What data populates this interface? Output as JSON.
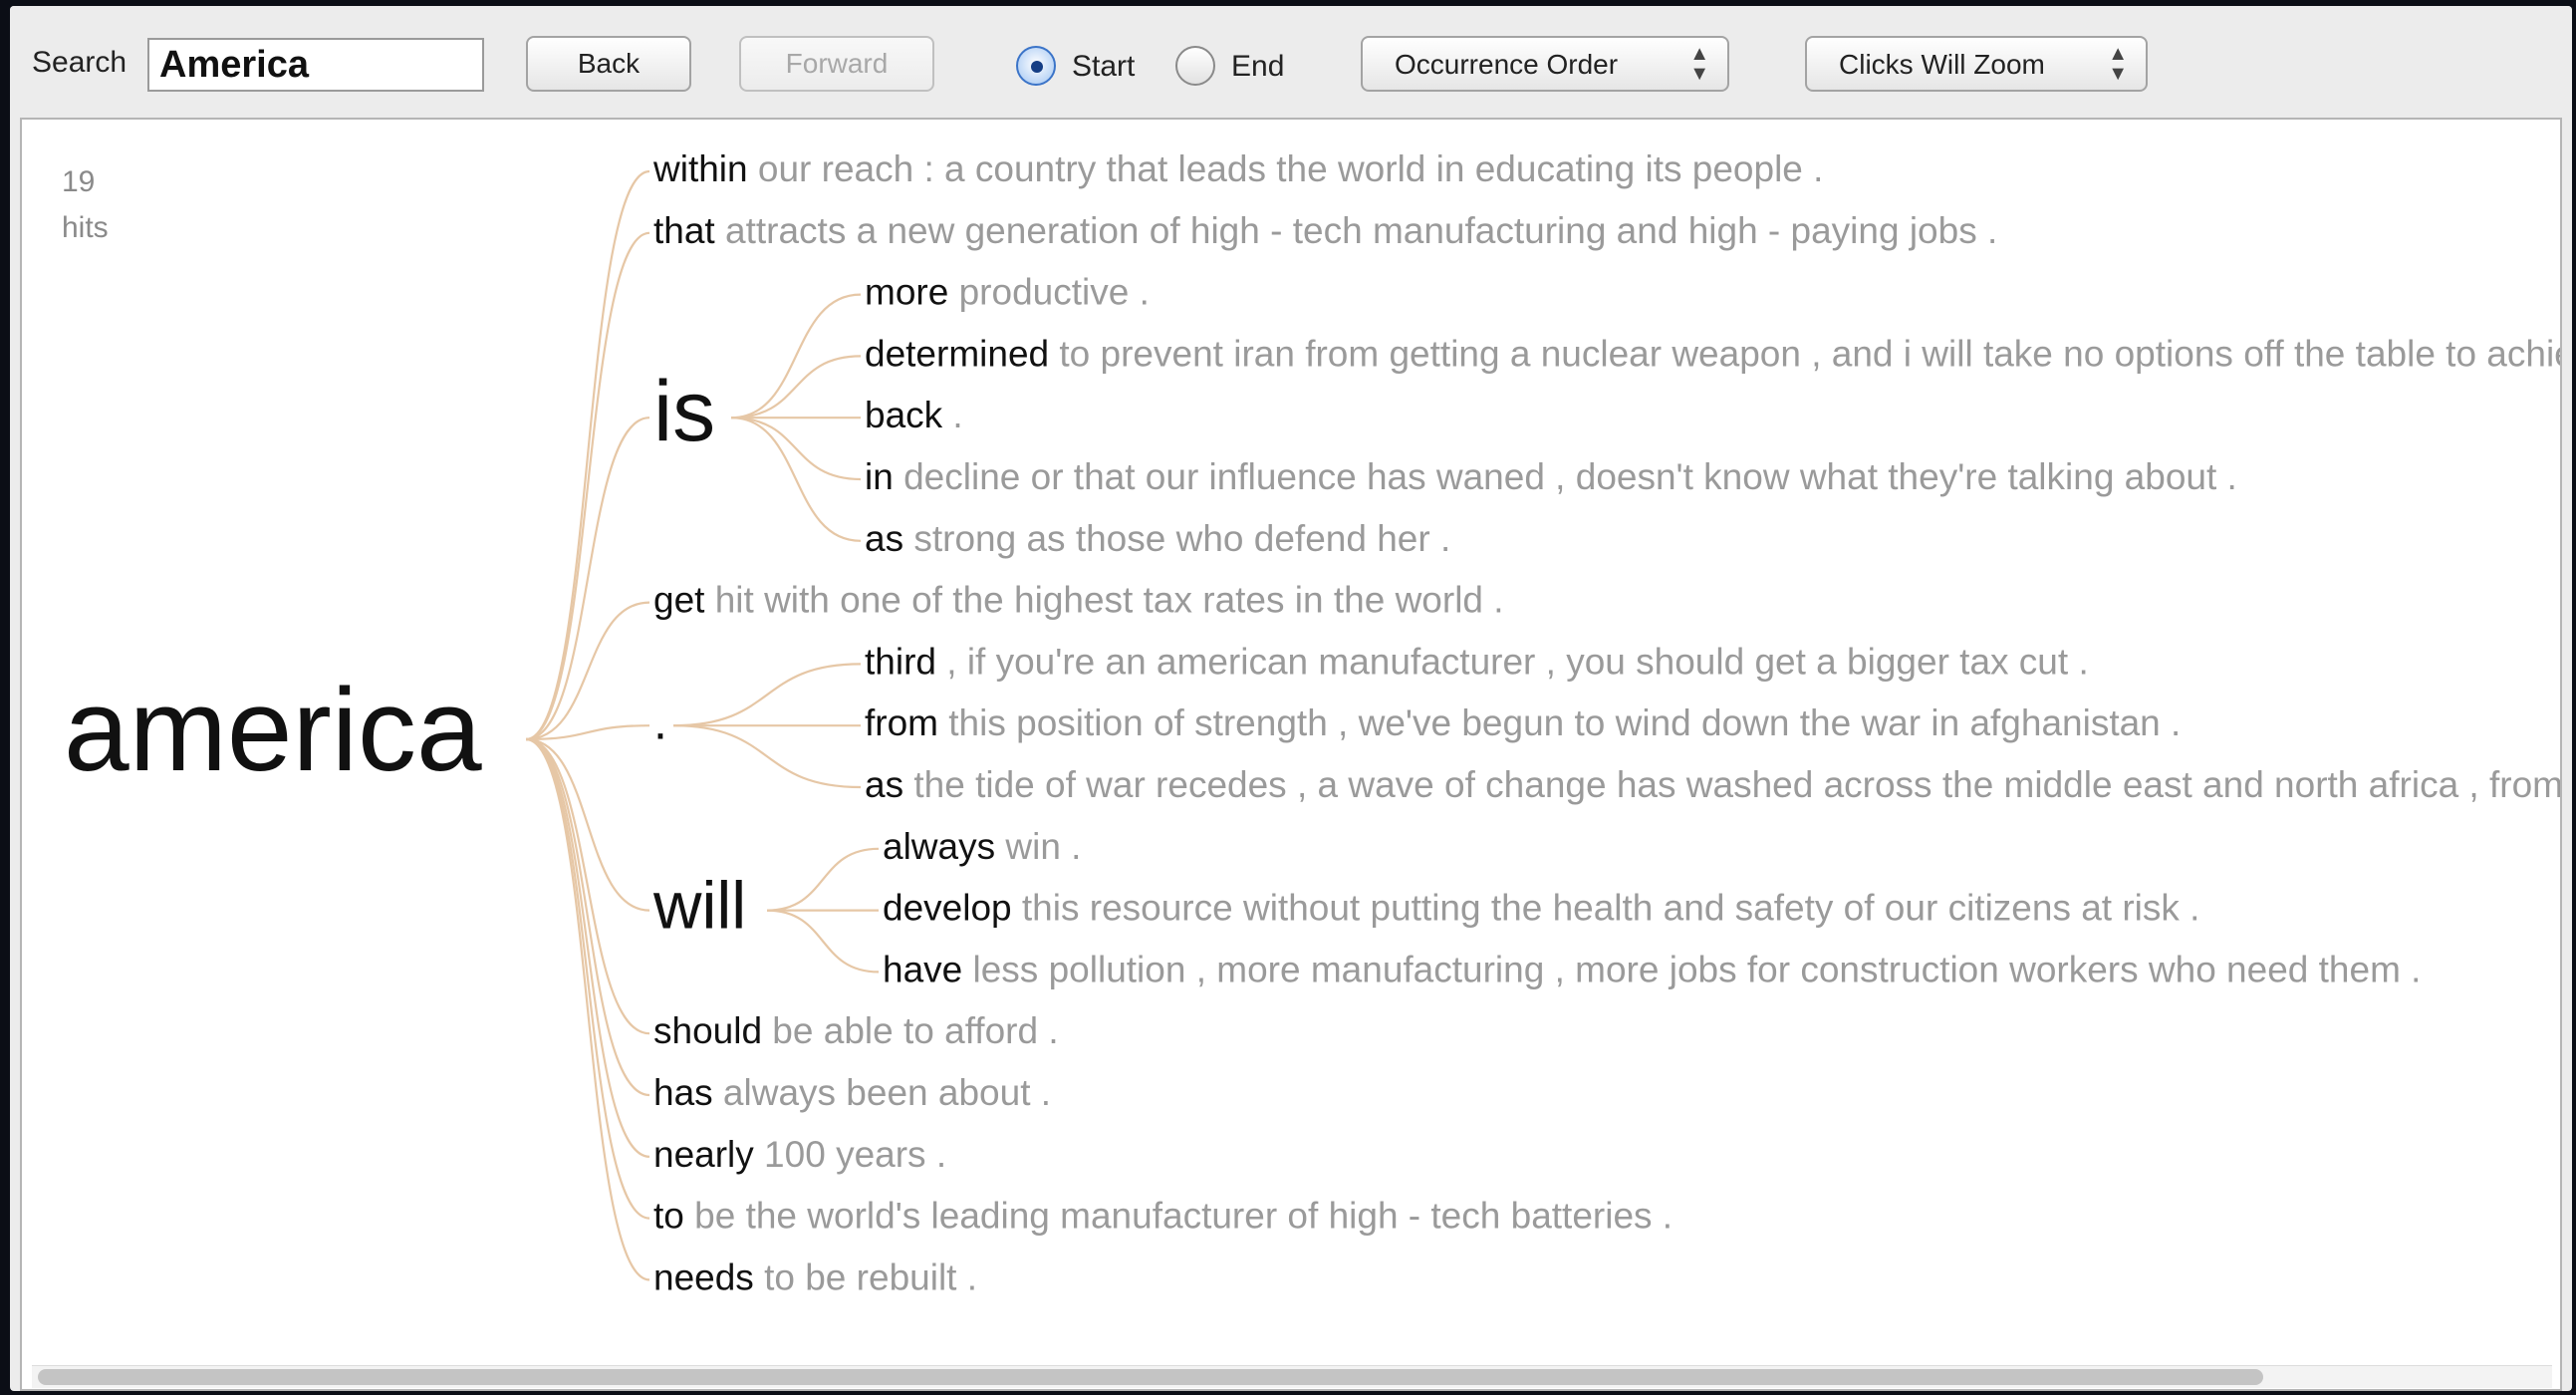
{
  "toolbar": {
    "search_label": "Search",
    "search_value": "America",
    "back_label": "Back",
    "forward_label": "Forward",
    "radio_start_label": "Start",
    "radio_end_label": "End",
    "order_select_value": "Occurrence Order",
    "zoom_select_value": "Clicks Will Zoom"
  },
  "hits": {
    "count": "19",
    "label": "hits"
  },
  "tree": {
    "root": "america",
    "branches": [
      {
        "word": "within",
        "rest": "our reach : a country that leads the world in educating its people ."
      },
      {
        "word": "that",
        "rest": "attracts a new generation of high - tech manufacturing and high - paying jobs ."
      },
      {
        "word": "is",
        "big": true,
        "children": [
          {
            "word": "more",
            "rest": "productive ."
          },
          {
            "word": "determined",
            "rest": "to prevent iran from getting a nuclear weapon , and i will take no options off the table to achieve that goal ."
          },
          {
            "word": "back",
            "rest": "."
          },
          {
            "word": "in",
            "rest": "decline or that our influence has waned , doesn't know what they're talking about ."
          },
          {
            "word": "as",
            "rest": "strong as those who defend her ."
          }
        ]
      },
      {
        "word": "get",
        "rest": "hit with one of the highest tax rates in the world ."
      },
      {
        "word": ".",
        "big": true,
        "children": [
          {
            "word": "third",
            "rest": ", if you're an american manufacturer , you should get a bigger tax cut ."
          },
          {
            "word": "from",
            "rest": "this position of strength , we've begun to wind down the war in afghanistan ."
          },
          {
            "word": "as",
            "rest": "the tide of war recedes , a wave of change has washed across the middle east and north africa , from tunis to cairo ."
          }
        ]
      },
      {
        "word": "will",
        "big": true,
        "children": [
          {
            "word": "always",
            "rest": "win ."
          },
          {
            "word": "develop",
            "rest": "this resource without putting the health and safety of our citizens at risk ."
          },
          {
            "word": "have",
            "rest": "less pollution , more manufacturing , more jobs for construction workers who need them ."
          }
        ]
      },
      {
        "word": "should",
        "rest": "be able to afford ."
      },
      {
        "word": "has",
        "rest": "always been about ."
      },
      {
        "word": "nearly",
        "rest": "100 years ."
      },
      {
        "word": "to",
        "rest": "be the world's leading manufacturer of high - tech batteries ."
      },
      {
        "word": "needs",
        "rest": "to be rebuilt ."
      }
    ]
  },
  "colors": {
    "branch": "#e6c7a6",
    "word": "#111111",
    "context": "#9a9a9a",
    "radio_selected": "#3b74c8"
  },
  "icons": {
    "select_arrows": "updown-chevron-icon"
  }
}
